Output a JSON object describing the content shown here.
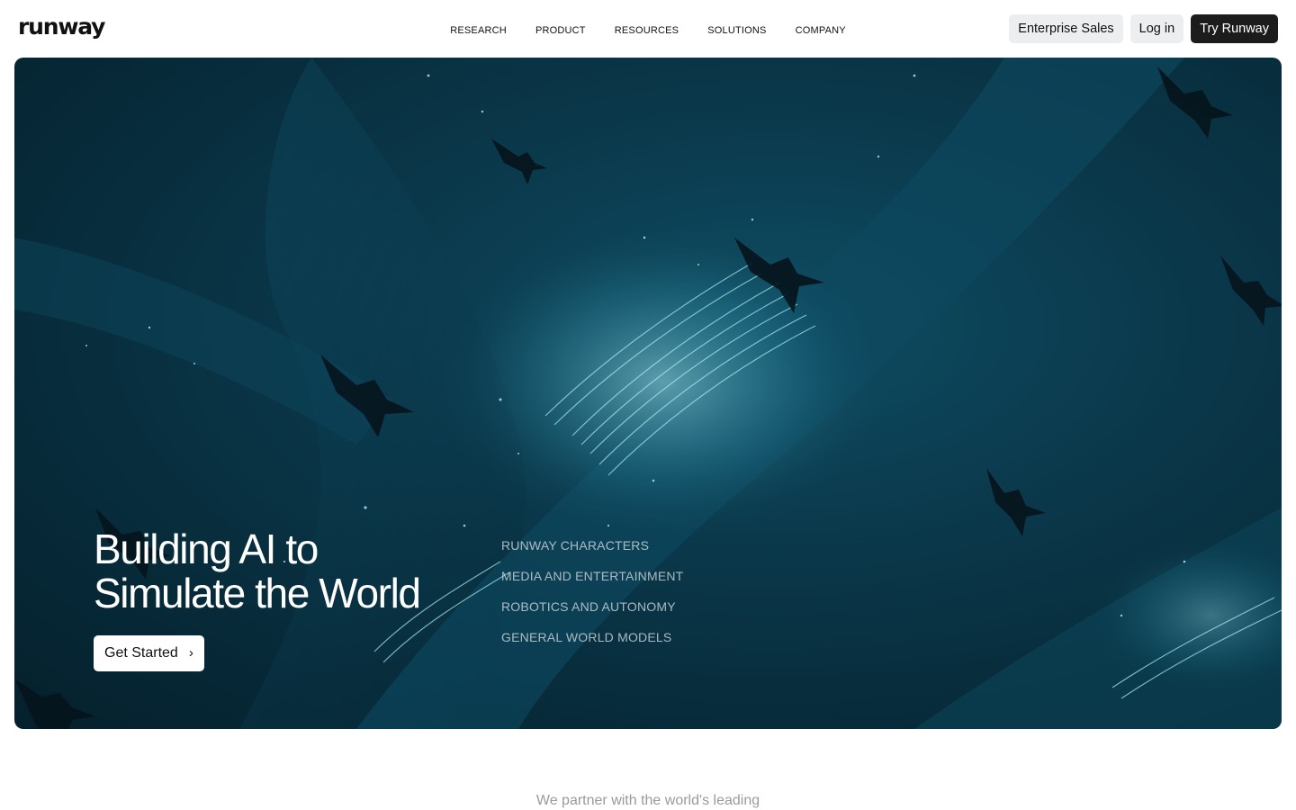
{
  "header": {
    "logo": "runway",
    "nav": [
      {
        "label": "RESEARCH"
      },
      {
        "label": "PRODUCT"
      },
      {
        "label": "RESOURCES"
      },
      {
        "label": "SOLUTIONS"
      },
      {
        "label": "COMPANY"
      }
    ],
    "enterprise_label": "Enterprise Sales",
    "login_label": "Log in",
    "try_label": "Try Runway"
  },
  "hero": {
    "title_line1": "Building AI to",
    "title_line2": "Simulate the World",
    "cta_label": "Get Started",
    "cta_icon": "chevron-right-icon",
    "links": [
      {
        "label": "RUNWAY CHARACTERS"
      },
      {
        "label": "MEDIA AND ENTERTAINMENT"
      },
      {
        "label": "ROBOTICS AND AUTONOMY"
      },
      {
        "label": "GENERAL WORLD MODELS"
      }
    ]
  },
  "partner_text": "We partner with the world's leading",
  "colors": {
    "hero_bg": "#0b3a4d",
    "accent_glow": "#7fe0f0",
    "try_button": "#1c1c1c"
  }
}
